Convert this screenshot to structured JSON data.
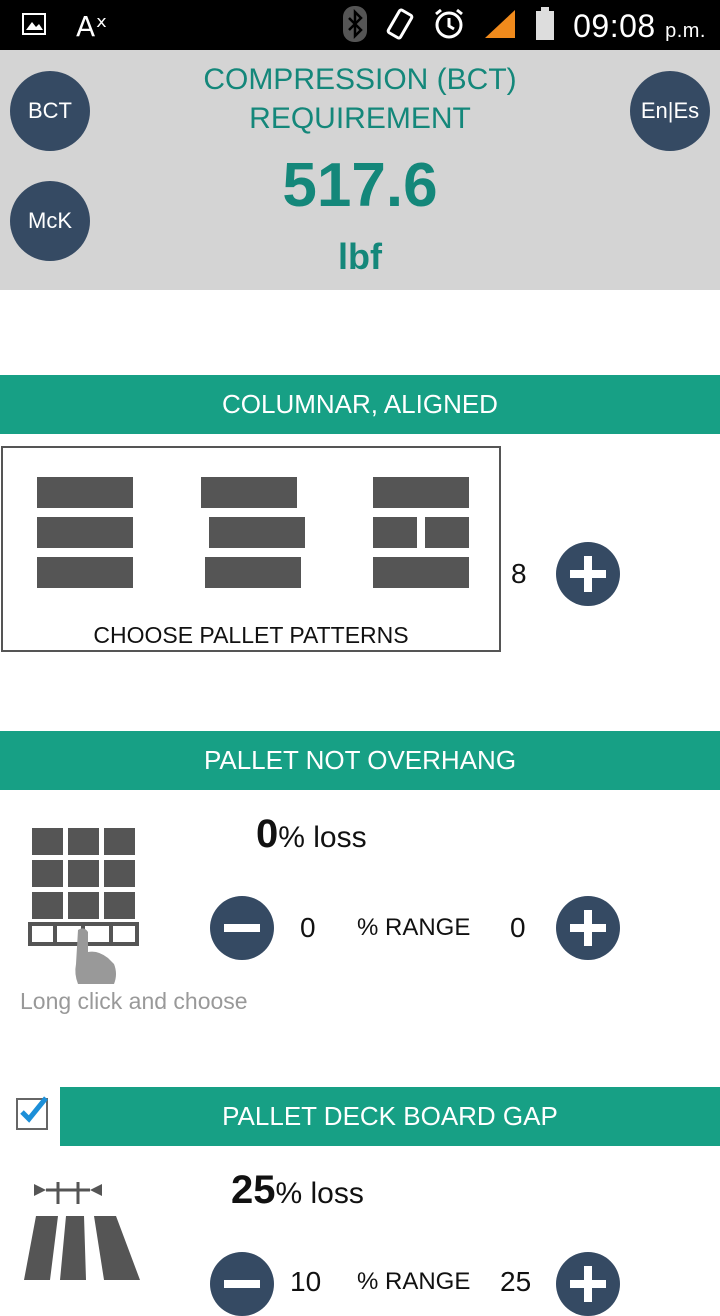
{
  "status_bar": {
    "time": "09:08",
    "ampm": "p.m.",
    "icons": [
      "gallery-icon",
      "font-icon",
      "bluetooth-icon",
      "vibrate-icon",
      "alarm-icon",
      "signal-icon",
      "battery-icon"
    ],
    "ax": "Aˣ"
  },
  "header": {
    "title_line1": "COMPRESSION (BCT)",
    "title_line2": "REQUIREMENT",
    "value": "517.6",
    "unit": "lbf",
    "btn_bct": "BCT",
    "btn_mck": "McK",
    "btn_lang": "En|Es"
  },
  "sections": {
    "columnar": {
      "title": "COLUMNAR, ALIGNED",
      "patterns_label": "CHOOSE PALLET PATTERNS",
      "count": "8"
    },
    "overhang": {
      "title": "PALLET NOT OVERHANG",
      "loss_value": "0",
      "loss_suffix": "% loss",
      "range_min": "0",
      "range_label": "% RANGE",
      "range_max": "0",
      "hint": "Long click and choose"
    },
    "deck_gap": {
      "title": "PALLET DECK BOARD GAP",
      "checked": true,
      "loss_value": "25",
      "loss_suffix": "% loss",
      "range_min": "10",
      "range_label": "% RANGE",
      "range_max": "25"
    }
  },
  "colors": {
    "accent": "#17a085",
    "title_text": "#14877a",
    "button": "#354a63",
    "header_bg": "#d4d4d4"
  }
}
